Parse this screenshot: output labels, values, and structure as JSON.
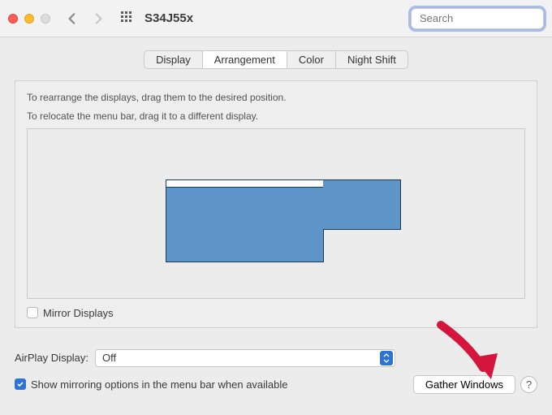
{
  "window": {
    "title": "S34J55x"
  },
  "search": {
    "placeholder": "Search",
    "value": ""
  },
  "tabs": {
    "display": "Display",
    "arrangement": "Arrangement",
    "color": "Color",
    "night_shift": "Night Shift"
  },
  "instructions": {
    "line1": "To rearrange the displays, drag them to the desired position.",
    "line2": "To relocate the menu bar, drag it to a different display."
  },
  "mirror": {
    "label": "Mirror Displays",
    "checked": false
  },
  "airplay": {
    "label": "AirPlay Display:",
    "value": "Off"
  },
  "show_mirroring": {
    "label": "Show mirroring options in the menu bar when available",
    "checked": true
  },
  "buttons": {
    "gather": "Gather Windows",
    "help": "?"
  }
}
